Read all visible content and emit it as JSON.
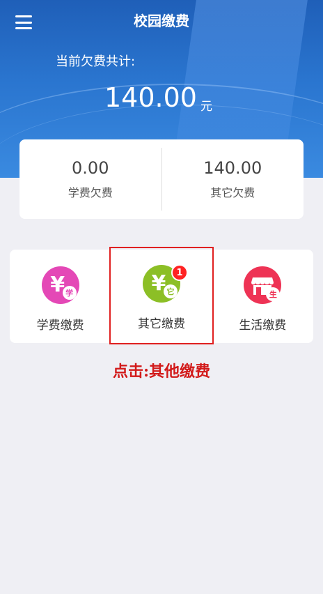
{
  "header": {
    "title": "校园缴费",
    "debt_label": "当前欠费共计:",
    "debt_amount": "140.00",
    "debt_unit": "元"
  },
  "summary": {
    "tuition": {
      "value": "0.00",
      "label": "学费欠费"
    },
    "other": {
      "value": "140.00",
      "label": "其它欠费"
    }
  },
  "payments": [
    {
      "label": "学费缴费",
      "icon": "tuition-yen-icon",
      "mini": "学",
      "color": "#e040b0"
    },
    {
      "label": "其它缴费",
      "icon": "other-yen-icon",
      "mini": "它",
      "color": "#8cbf26",
      "badge": "1"
    },
    {
      "label": "生活缴费",
      "icon": "store-icon",
      "mini": "生",
      "color": "#ee3355"
    }
  ],
  "hint": "点击:其他缴费"
}
